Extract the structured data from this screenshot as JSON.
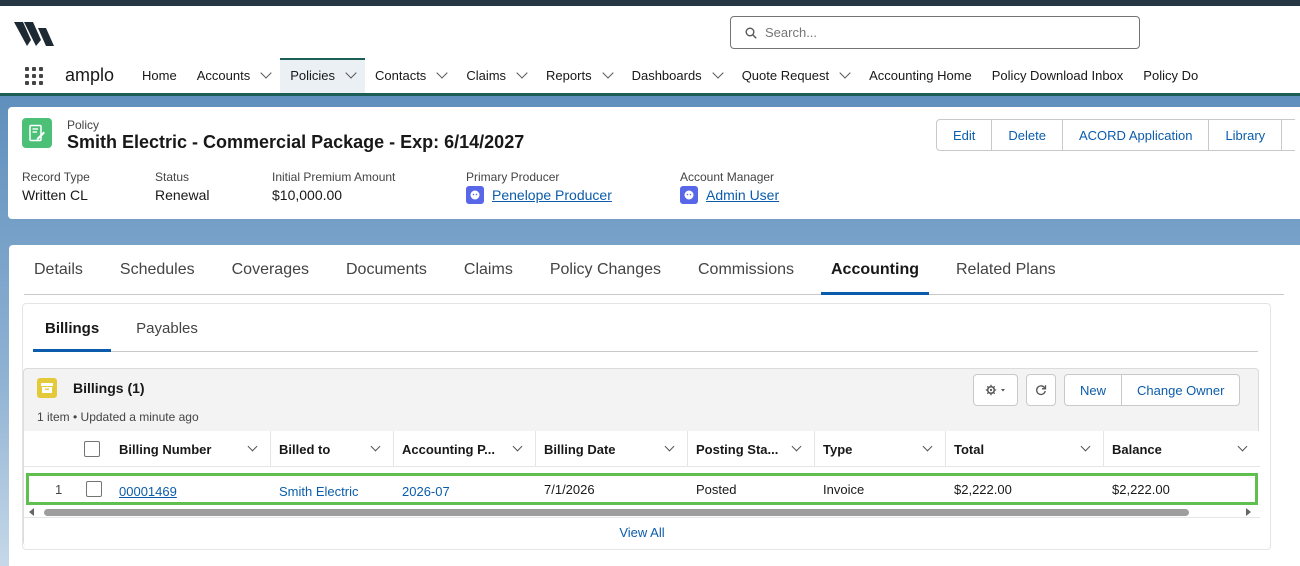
{
  "header": {
    "search_placeholder": "Search..."
  },
  "nav": {
    "app_name": "amplo",
    "items": [
      {
        "label": "Home"
      },
      {
        "label": "Accounts"
      },
      {
        "label": "Policies"
      },
      {
        "label": "Contacts"
      },
      {
        "label": "Claims"
      },
      {
        "label": "Reports"
      },
      {
        "label": "Dashboards"
      },
      {
        "label": "Quote Request"
      },
      {
        "label": "Accounting Home"
      },
      {
        "label": "Policy Download Inbox"
      },
      {
        "label": "Policy Do"
      }
    ]
  },
  "record": {
    "object_label": "Policy",
    "title": "Smith Electric - Commercial Package - Exp: 6/14/2027",
    "actions": [
      "Edit",
      "Delete",
      "ACORD Application",
      "Library"
    ],
    "fields": [
      {
        "label": "Record Type",
        "value": "Written CL"
      },
      {
        "label": "Status",
        "value": "Renewal"
      },
      {
        "label": "Initial Premium Amount",
        "value": "$10,000.00"
      },
      {
        "label": "Primary Producer",
        "value": "Penelope Producer"
      },
      {
        "label": "Account Manager",
        "value": "Admin User"
      }
    ]
  },
  "tabs": [
    "Details",
    "Schedules",
    "Coverages",
    "Documents",
    "Claims",
    "Policy Changes",
    "Commissions",
    "Accounting",
    "Related Plans"
  ],
  "subtabs": [
    "Billings",
    "Payables"
  ],
  "related_list": {
    "title": "Billings (1)",
    "meta": "1 item • Updated a minute ago",
    "buttons": [
      "New",
      "Change Owner"
    ],
    "columns": [
      "Billing Number",
      "Billed to",
      "Accounting P...",
      "Billing Date",
      "Posting Sta...",
      "Type",
      "Total",
      "Balance"
    ],
    "rows": [
      {
        "index": "1",
        "billing_number": "00001469",
        "billed_to": "Smith Electric",
        "accounting_period": "2026-07",
        "billing_date": "7/1/2026",
        "posting_status": "Posted",
        "type": "Invoice",
        "total": "$2,222.00",
        "balance": "$2,222.00"
      }
    ],
    "view_all": "View All"
  },
  "colors": {
    "brand_dark": "#253744",
    "nav_accent": "#1b5e55",
    "link": "#0b5cab",
    "record_icon": "#4bc076",
    "billing_icon": "#e4ca3a",
    "highlight": "#5fbf4f"
  }
}
